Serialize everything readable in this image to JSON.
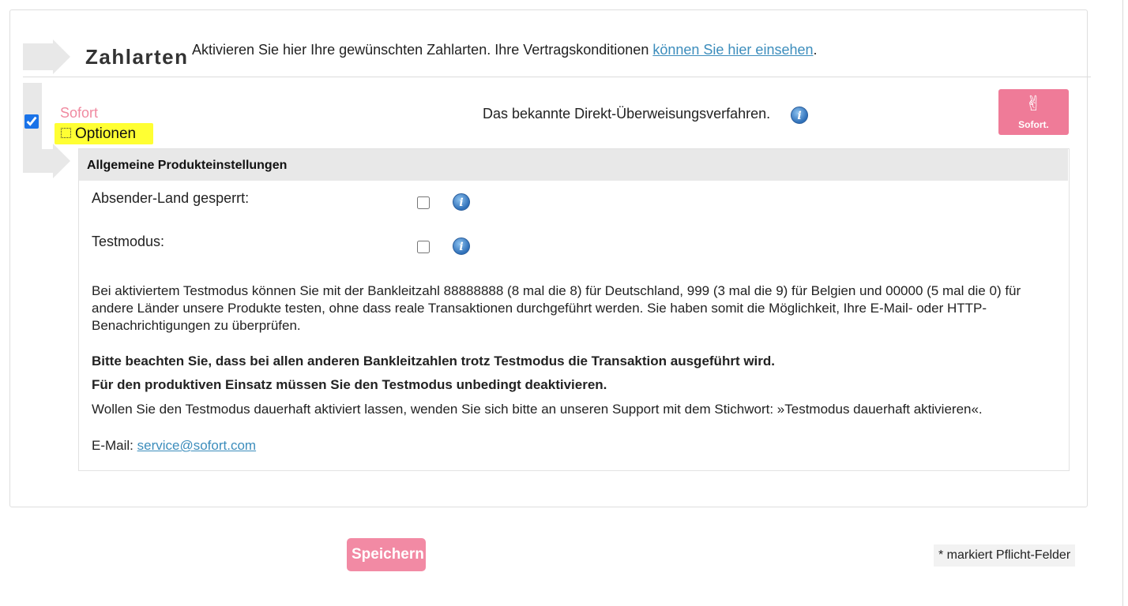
{
  "section": {
    "title": "Zahlarten",
    "intro_text": "Aktivieren Sie hier Ihre gewünschten Zahlarten. Ihre Vertragskonditionen ",
    "intro_link": "können Sie hier einsehen",
    "intro_end": "."
  },
  "payment_method": {
    "enabled": true,
    "name": "Sofort",
    "options_label": "Optionen",
    "description": "Das bekannte Direkt-Überweisungsverfahren.",
    "logo_text": "Sofort.",
    "logo_symbol": "✌",
    "brand_color": "#ef7b98",
    "options_highlight_color": "#ffff33"
  },
  "settings": {
    "header": "Allgemeine Produkteinstellungen",
    "fields": [
      {
        "label": "Absender-Land gesperrt:",
        "checked": false
      },
      {
        "label": "Testmodus:",
        "checked": false
      }
    ],
    "info_icon": "info-icon",
    "test_info": "Bei aktiviertem Testmodus können Sie mit der Bankleitzahl 88888888 (8 mal die 8) für Deutschland, 999 (3 mal die 9) für Belgien und 00000 (5 mal die 0) für andere Länder unsere Produkte testen, ohne dass reale Transaktionen durchgeführt werden. Sie haben somit die Möglichkeit, Ihre E-Mail- oder HTTP-Benachrichtigungen zu überprüfen.",
    "warning1": "Bitte beachten Sie, dass bei allen anderen Bankleitzahlen trotz Testmodus die Transaktion ausgeführt wird.",
    "warning2": "Für den produktiven Einsatz müssen Sie den Testmodus unbedingt deaktivieren.",
    "support_text": "Wollen Sie den Testmodus dauerhaft aktiviert lassen, wenden Sie sich bitte an unseren Support mit dem Stichwort: »Testmodus dauerhaft aktivieren«.",
    "email_label": "E-Mail: ",
    "email": "service@sofort.com"
  },
  "footer": {
    "save_label": "Speichern",
    "required_note": "* markiert Pflicht-Felder",
    "save_color": "#f28aa4"
  },
  "colors": {
    "link": "#3c8dbc",
    "arrow_gray": "#e8e8e8"
  }
}
